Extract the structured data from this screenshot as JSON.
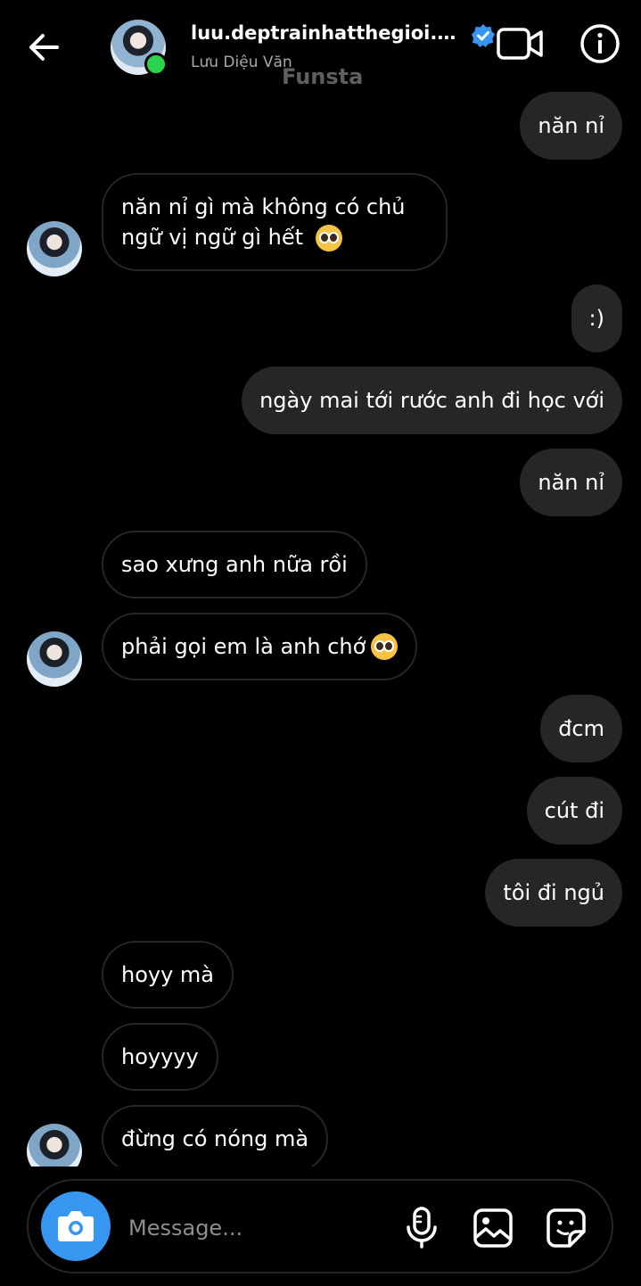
{
  "header": {
    "username": "luu.deptrainhatthegioi.dieu...",
    "display_name": "Lưu Diệu Văn",
    "watermark": "Funsta",
    "icons": [
      "back-arrow-icon",
      "verified-badge-icon",
      "video-call-icon",
      "info-icon"
    ],
    "online_color": "#2bd24c",
    "verified_color": "#3797f0"
  },
  "messages": [
    {
      "from": "me",
      "text": "năn nỉ"
    },
    {
      "from": "them",
      "text": "năn nỉ gì mà không có chủ ngữ vị ngữ gì hết",
      "emoji": "pleading-face-emoji"
    },
    {
      "from": "me",
      "text": ":)"
    },
    {
      "from": "me",
      "text": "ngày mai tới rước anh đi học với"
    },
    {
      "from": "me",
      "text": "năn nỉ"
    },
    {
      "from": "them",
      "text": "sao xưng anh nữa rồi"
    },
    {
      "from": "them",
      "text": "phải gọi em là anh chớ",
      "emoji": "pleading-face-emoji"
    },
    {
      "from": "me",
      "text": "đcm"
    },
    {
      "from": "me",
      "text": "cút đi"
    },
    {
      "from": "me",
      "text": "tôi đi ngủ"
    },
    {
      "from": "them",
      "text": "hoyy mà"
    },
    {
      "from": "them",
      "text": "hoyyyy"
    },
    {
      "from": "them",
      "text": "đừng có nóng mà"
    }
  ],
  "composer": {
    "placeholder": "Message...",
    "icons": [
      "camera-icon",
      "microphone-icon",
      "gallery-icon",
      "sticker-icon"
    ],
    "accent": "#3797f0"
  },
  "colors": {
    "background": "#000000",
    "sent_bubble": "#262626",
    "received_border": "#262626"
  }
}
